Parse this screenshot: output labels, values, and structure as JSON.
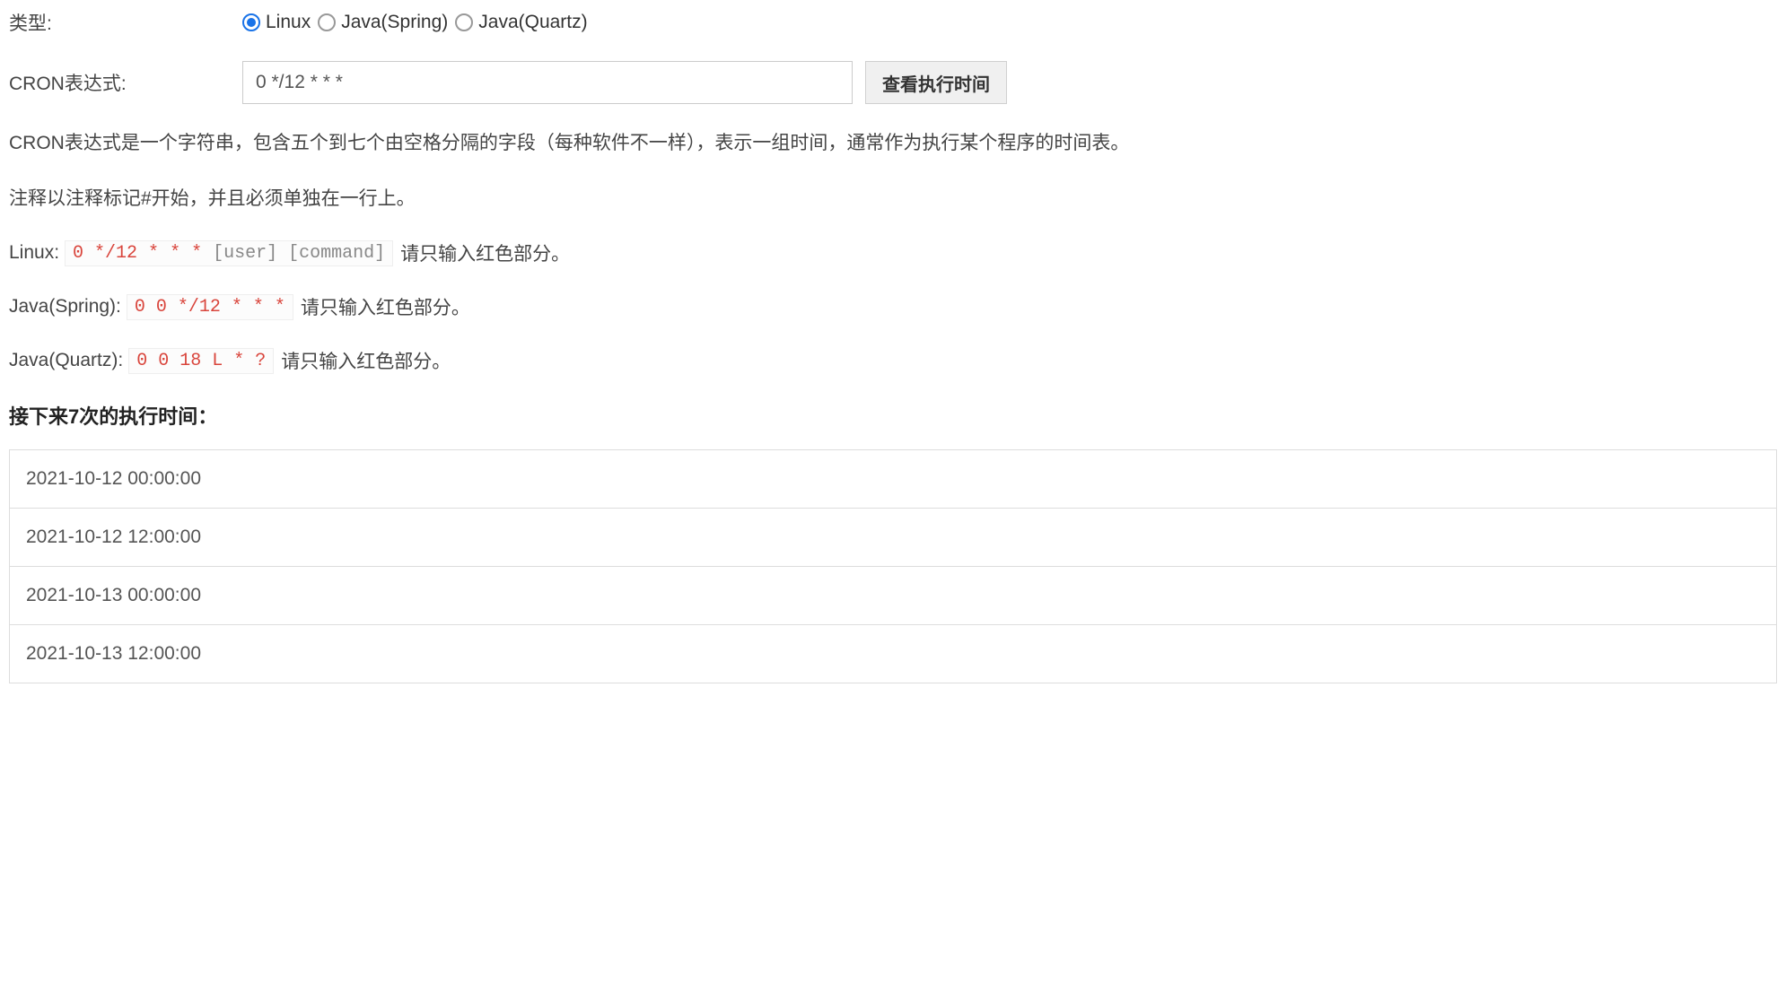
{
  "form": {
    "type_label": "类型:",
    "radios": [
      {
        "label": "Linux",
        "checked": true
      },
      {
        "label": "Java(Spring)",
        "checked": false
      },
      {
        "label": "Java(Quartz)",
        "checked": false
      }
    ],
    "cron_label": "CRON表达式:",
    "cron_value": "0 */12 * * *",
    "check_button": "查看执行时间"
  },
  "description": {
    "para1": "CRON表达式是一个字符串，包含五个到七个由空格分隔的字段（每种软件不一样），表示一组时间，通常作为执行某个程序的时间表。",
    "para2": "注释以注释标记#开始，并且必须单独在一行上。"
  },
  "examples": [
    {
      "label": "Linux:",
      "code_red": "0 */12 * * *",
      "code_gray": " [user] [command]",
      "hint": "请只输入红色部分。"
    },
    {
      "label": "Java(Spring):",
      "code_red": "0 0 */12 * * *",
      "code_gray": "",
      "hint": "请只输入红色部分。"
    },
    {
      "label": "Java(Quartz):",
      "code_red": "0 0 18 L * ?",
      "code_gray": "",
      "hint": "请只输入红色部分。"
    }
  ],
  "results": {
    "title": "接下来7次的执行时间：",
    "times": [
      "2021-10-12 00:00:00",
      "2021-10-12 12:00:00",
      "2021-10-13 00:00:00",
      "2021-10-13 12:00:00"
    ]
  }
}
